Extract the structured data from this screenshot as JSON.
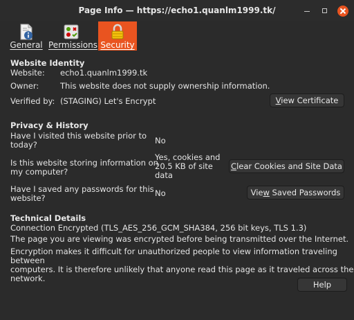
{
  "window": {
    "title": "Page Info — https://echo1.quanlm1999.tk/"
  },
  "tabs": [
    {
      "label": "General",
      "mnemonic": "G",
      "icon": "page-info-icon"
    },
    {
      "label": "Permissions",
      "mnemonic": "P",
      "icon": "permissions-icon"
    },
    {
      "label": "Security",
      "mnemonic": "S",
      "icon": "lock-icon",
      "active": true
    }
  ],
  "identity": {
    "heading": "Website Identity",
    "website_label": "Website:",
    "website_value": "echo1.quanlm1999.tk",
    "owner_label": "Owner:",
    "owner_value": "This website does not supply ownership information.",
    "verified_label": "Verified by:",
    "verified_value": "(STAGING) Let's Encrypt",
    "view_cert_pre": "",
    "view_cert_mn": "V",
    "view_cert_post": "iew Certificate"
  },
  "privacy": {
    "heading": "Privacy & History",
    "q1_line1": "Have I visited this website prior to",
    "q1_line2": "today?",
    "a1": "No",
    "q2_line1": "Is this website storing information on",
    "q2_line2": "my computer?",
    "a2_line1": "Yes, cookies and",
    "a2_line2": "20.5 KB of site",
    "a2_line3": "data",
    "clear_pre": "",
    "clear_mn": "C",
    "clear_post": "lear Cookies and Site Data",
    "q3_line1": "Have I saved any passwords for this",
    "q3_line2": "website?",
    "a3": "No",
    "saved_pre": "Vie",
    "saved_mn": "w",
    "saved_post": " Saved Passwords"
  },
  "technical": {
    "heading": "Technical Details",
    "line1": "Connection Encrypted (TLS_AES_256_GCM_SHA384, 256 bit keys, TLS 1.3)",
    "line2": "The page you are viewing was encrypted before being transmitted over the Internet.",
    "para_line1": "Encryption makes it difficult for unauthorized people to view information traveling between",
    "para_line2": "computers. It is therefore unlikely that anyone read this page as it traveled across the",
    "para_line3": "network."
  },
  "help_label": "Help",
  "colors": {
    "accent": "#e95420",
    "background": "#2b2b2b",
    "button": "#363636"
  }
}
